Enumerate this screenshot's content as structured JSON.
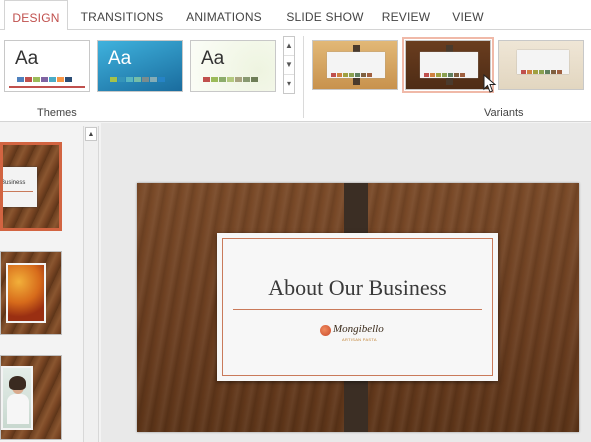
{
  "tabs": [
    {
      "label": "DESIGN",
      "active": true
    },
    {
      "label": "TRANSITIONS",
      "active": false
    },
    {
      "label": "ANIMATIONS",
      "active": false
    },
    {
      "label": "SLIDE SHOW",
      "active": false
    },
    {
      "label": "REVIEW",
      "active": false
    },
    {
      "label": "VIEW",
      "active": false
    }
  ],
  "themes": {
    "group_label": "Themes",
    "items": [
      {
        "sample_text": "Aa",
        "style": "office",
        "swatches": [
          "#4f81bd",
          "#c0504d",
          "#9bbb59",
          "#8064a2",
          "#4bacc6",
          "#f79646",
          "#2c4d75"
        ]
      },
      {
        "sample_text": "Aa",
        "style": "blue",
        "swatches": [
          "#a5c249",
          "#3494ba",
          "#58b6c0",
          "#75bda7",
          "#7a8c8e",
          "#84acb6",
          "#2683c6"
        ]
      },
      {
        "sample_text": "Aa",
        "style": "green",
        "swatches": [
          "#c0504d",
          "#9bbb59",
          "#8cad6b",
          "#b4c97f",
          "#a8a37f",
          "#889970",
          "#6e7e57"
        ]
      }
    ],
    "scroll_icons": [
      "up-arrow-icon",
      "down-arrow-icon",
      "more-icon"
    ]
  },
  "variants": {
    "group_label": "Variants",
    "items": [
      {
        "style": "light-wood",
        "selected": false
      },
      {
        "style": "dark-wood",
        "selected": true
      },
      {
        "style": "white-wood",
        "selected": false
      }
    ]
  },
  "slide": {
    "title": "About Our Business",
    "logo_name": "Mongibello",
    "logo_sub": "ARTISAN PASTA"
  },
  "thumbnails": [
    {
      "text": "Business",
      "selected": true
    },
    {
      "text": "",
      "selected": false
    },
    {
      "text": "",
      "selected": false
    }
  ],
  "colors": {
    "accent": "#c0504d",
    "selection_border": "#d26441",
    "strap": "#3b2e24"
  }
}
